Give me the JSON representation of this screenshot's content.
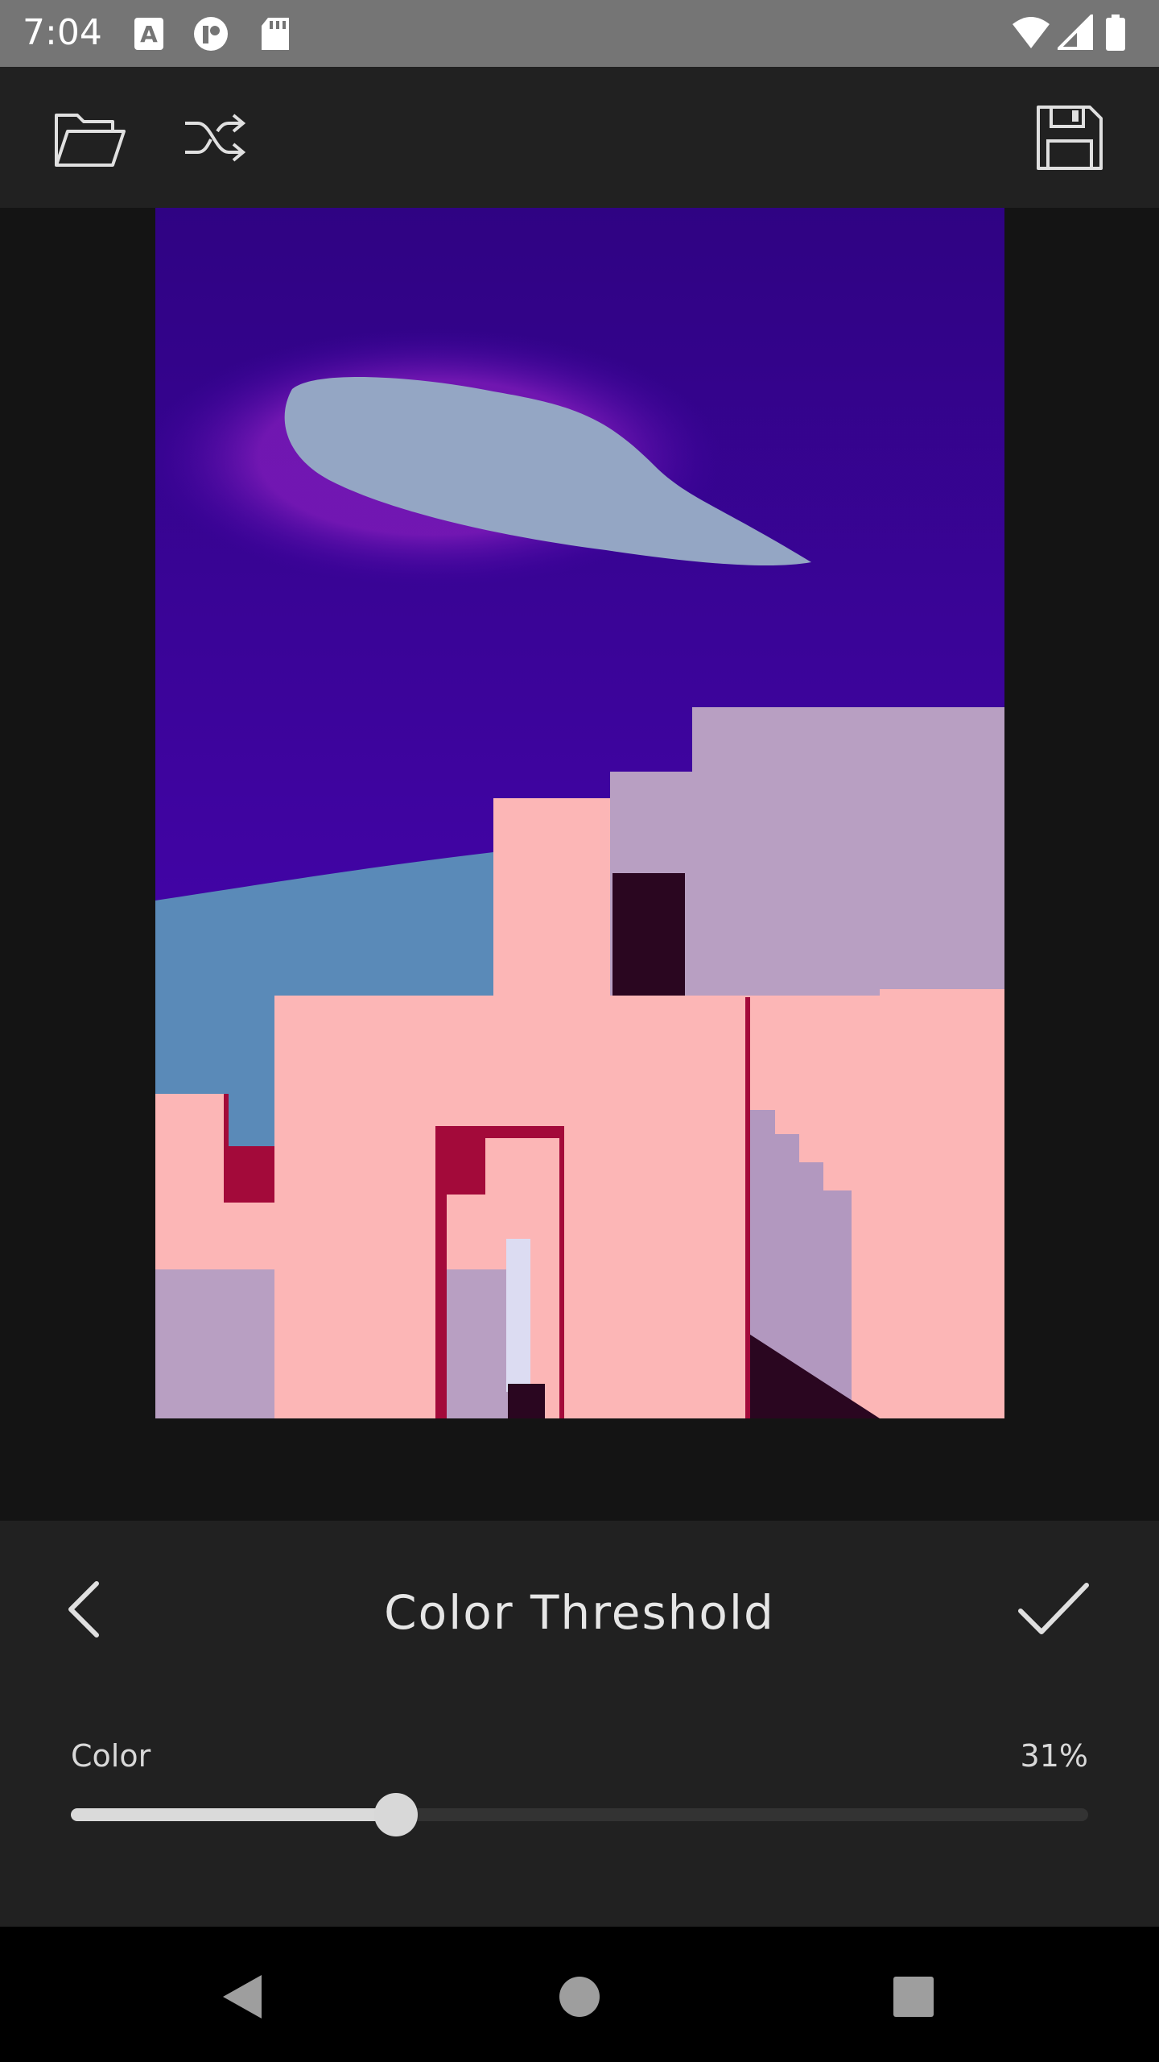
{
  "status_bar": {
    "time": "7:04",
    "left_icons": [
      "text-a-icon",
      "vpn-key-icon",
      "sd-card-icon"
    ],
    "right_icons": [
      "wifi-icon",
      "cell-signal-icon",
      "battery-icon"
    ]
  },
  "toolbar": {
    "icons": [
      "folder-open-icon",
      "shuffle-icon",
      "save-icon"
    ]
  },
  "preview": {
    "description_colors": {
      "sky": "#3c0399",
      "cloud": "#94a6c4",
      "lower_sky": "#5a8ab8",
      "pink_wall": "#fcb6b6",
      "lilac_wall": "#b89fc2",
      "crimson": "#a30a3a"
    }
  },
  "panel": {
    "title": "Color Threshold",
    "back_icon": "chevron-left-icon",
    "apply_icon": "checkmark-icon",
    "slider": {
      "label": "Color",
      "value_text": "31%",
      "value": 0.32
    }
  },
  "nav_bar": {
    "icons": [
      "back-triangle-icon",
      "home-circle-icon",
      "recents-square-icon"
    ]
  },
  "colors": {
    "status_bar_bg": "#757575",
    "toolbar_bg": "#212121",
    "canvas_bg": "#141414",
    "panel_bg": "#212121",
    "nav_bg": "#000000",
    "slider_active": "#dadada",
    "slider_inactive": "#333333"
  }
}
